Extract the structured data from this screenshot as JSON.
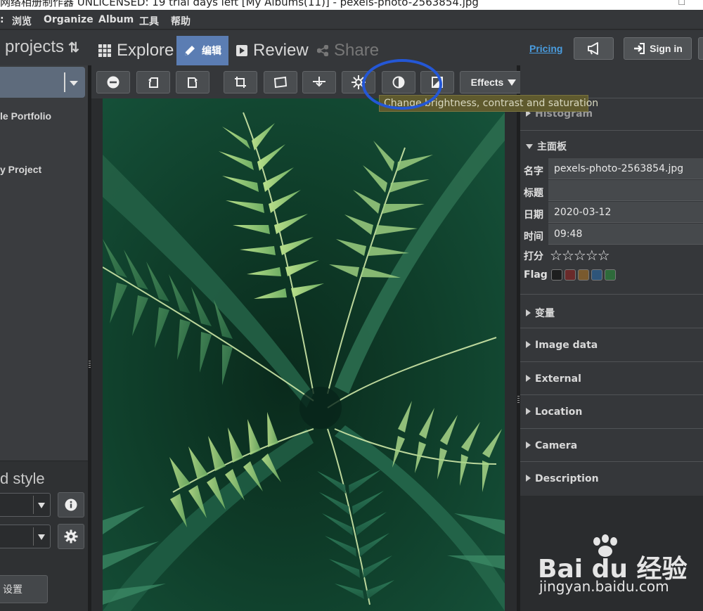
{
  "window": {
    "title": "网络相册制作器 UNLICENSED: 19 trial days left [My Albums(11)] - pexels-photo-2563854.jpg"
  },
  "menu": {
    "items": [
      "浏览",
      "Organize",
      "Album",
      "工具",
      "帮助"
    ]
  },
  "nav": {
    "projects_label": "projects",
    "explore_label": "Explore",
    "edit_label": "编辑",
    "review_label": "Review",
    "share_label": "Share",
    "pricing_label": "Pricing",
    "signin_label": "Sign in"
  },
  "left_panel": {
    "items": [
      "le Portfolio",
      "y Project"
    ],
    "style_title": "d style",
    "settings_label": "设置"
  },
  "toolbar": {
    "effects_label": "Effects",
    "tooltip": "Change brightness, contrast and saturation"
  },
  "right_panel": {
    "histogram_label": "Histogram",
    "main_label": "主面板",
    "fields": [
      {
        "label": "名字",
        "value": "pexels-photo-2563854.jpg"
      },
      {
        "label": "标题",
        "value": ""
      },
      {
        "label": "日期",
        "value": "2020-03-12"
      },
      {
        "label": "时间",
        "value": "09:48"
      }
    ],
    "rating_label": "打分",
    "rating_value": 0,
    "rating_max": 5,
    "flag_label": "Flag",
    "flag_colors": [
      "#1e1e1e",
      "#6a2a2a",
      "#7a5a2e",
      "#2e557a",
      "#2e6a3a"
    ],
    "sections": [
      "变量",
      "Image data",
      "External",
      "Location",
      "Camera",
      "Description"
    ]
  },
  "watermark": {
    "logo_text": "Bai du 经验",
    "url": "jingyan.baidu.com"
  }
}
